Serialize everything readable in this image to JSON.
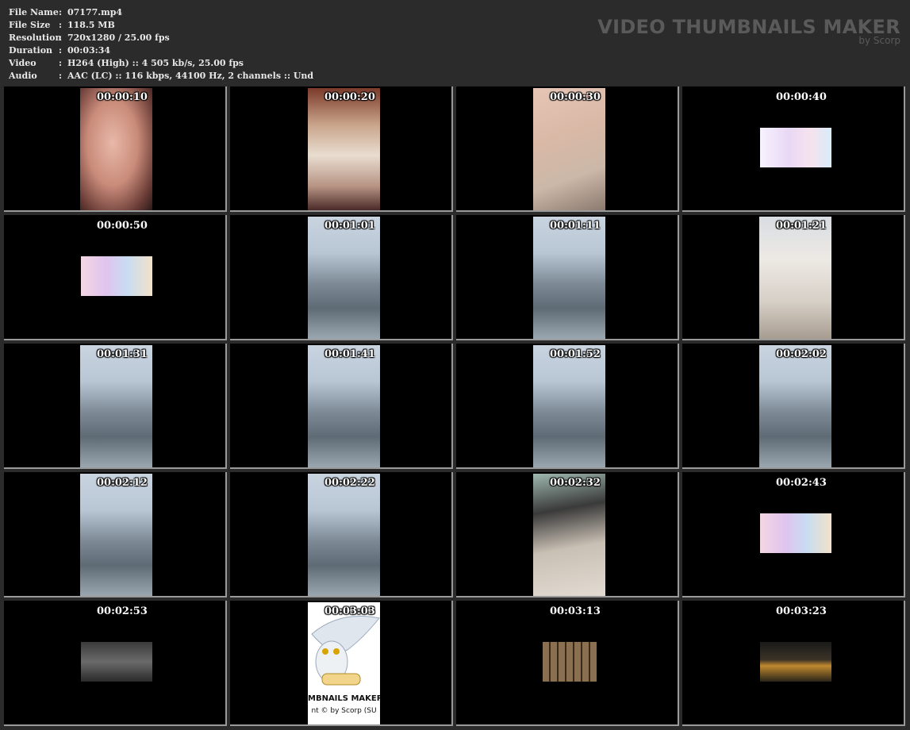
{
  "file_info": [
    {
      "key": "File Name",
      "sep": ":",
      "value": "07177.mp4"
    },
    {
      "key": "File Size",
      "sep": ":",
      "value": "118.5 MB"
    },
    {
      "key": "Resolution",
      "sep": ":",
      "value": "720x1280 / 25.00 fps"
    },
    {
      "key": "Duration",
      "sep": ":",
      "value": "00:03:34"
    },
    {
      "key": "Video",
      "sep": ":",
      "value": "H264 (High) :: 4 505 kb/s, 25.00 fps"
    },
    {
      "key": "Audio",
      "sep": ":",
      "value": "AAC (LC) :: 116 kbps, 44100 Hz, 2 channels :: Und"
    }
  ],
  "brand": {
    "title": "VIDEO THUMBNAILS MAKER",
    "subtitle": "by Scorp"
  },
  "thumbnails": [
    {
      "time": "00:00:10",
      "kind": "portrait-skin"
    },
    {
      "time": "00:00:20",
      "kind": "portrait-dress"
    },
    {
      "time": "00:00:30",
      "kind": "portrait-arm"
    },
    {
      "time": "00:00:40",
      "kind": "banner-pastel"
    },
    {
      "time": "00:00:50",
      "kind": "banner-anime"
    },
    {
      "time": "00:01:01",
      "kind": "portrait-street"
    },
    {
      "time": "00:01:11",
      "kind": "portrait-street"
    },
    {
      "time": "00:01:21",
      "kind": "portrait-coat"
    },
    {
      "time": "00:01:31",
      "kind": "portrait-street"
    },
    {
      "time": "00:01:41",
      "kind": "portrait-street"
    },
    {
      "time": "00:01:52",
      "kind": "portrait-street"
    },
    {
      "time": "00:02:02",
      "kind": "portrait-street"
    },
    {
      "time": "00:02:12",
      "kind": "portrait-street"
    },
    {
      "time": "00:02:22",
      "kind": "portrait-street"
    },
    {
      "time": "00:02:32",
      "kind": "portrait-hair"
    },
    {
      "time": "00:02:43",
      "kind": "banner-anime"
    },
    {
      "time": "00:02:53",
      "kind": "small-dark"
    },
    {
      "time": "00:03:03",
      "kind": "portrait-owl"
    },
    {
      "time": "00:03:13",
      "kind": "small-grid"
    },
    {
      "time": "00:03:23",
      "kind": "small-bottles"
    }
  ],
  "owl_caption": {
    "line1": "MBNAILS MAKER 8",
    "line2": "nt © by Scorp (SU"
  }
}
